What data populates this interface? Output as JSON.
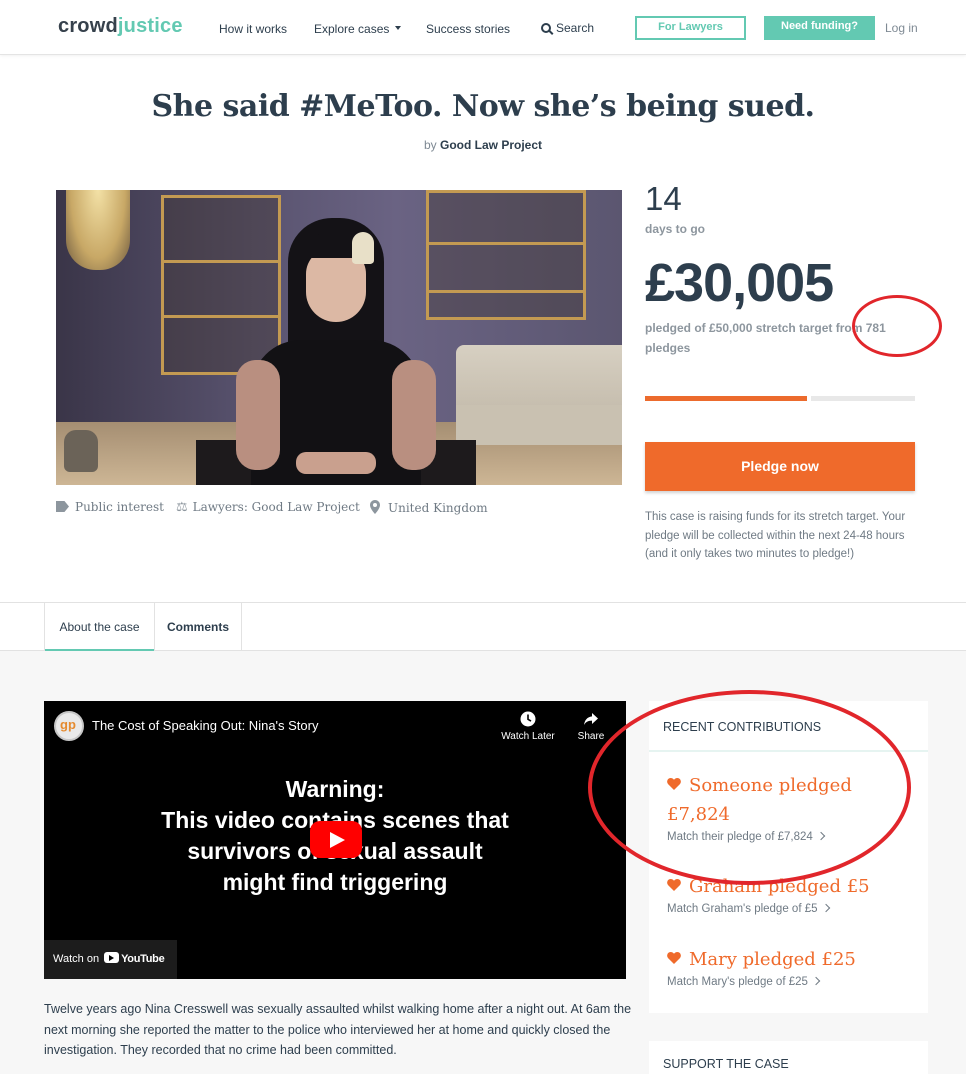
{
  "header": {
    "logo_part1": "crowd",
    "logo_part2": "justice",
    "nav": {
      "how_it_works": "How it works",
      "explore_cases": "Explore cases",
      "success_stories": "Success stories",
      "search": "Search"
    },
    "for_lawyers": "For Lawyers",
    "need_funding": "Need funding?",
    "login": "Log in"
  },
  "case": {
    "title": "She said #MeToo. Now she’s being sued.",
    "by_prefix": "by",
    "organiser": "Good Law Project",
    "meta": {
      "category": "Public interest",
      "lawyers": "Lawyers: Good Law Project",
      "location": "United Kingdom"
    }
  },
  "stats": {
    "days_number": "14",
    "days_label": "days to go",
    "amount": "£30,005",
    "pledged_text": "pledged of £50,000 stretch target from 781 pledges",
    "progress_fraction": 0.6,
    "pledge_button": "Pledge now",
    "stretch_note": "This case is raising funds for its stretch target. Your pledge will be collected within the next 24-48 hours (and it only takes two minutes to pledge!)"
  },
  "tabs": [
    {
      "label": "About the case",
      "active": true
    },
    {
      "label": "Comments",
      "active": false
    }
  ],
  "video": {
    "title": "The Cost of Speaking Out: Nina's Story",
    "watch_later": "Watch Later",
    "share": "Share",
    "warning_line1": "Warning:",
    "warning_line2": "This video contains scenes that",
    "warning_line3": "survivors of sexual assault",
    "warning_line4": "might find triggering",
    "watch_on": "Watch on",
    "youtube": "YouTube"
  },
  "story": {
    "paragraph": "Twelve years ago Nina Cresswell was sexually assaulted whilst walking home after a night out. At 6am the next morning she reported the matter to the police who interviewed her at home and quickly closed the investigation. They recorded that no crime had been committed."
  },
  "recent": {
    "heading": "RECENT CONTRIBUTIONS",
    "items": [
      {
        "headline": "Someone pledged £7,824",
        "sub": "Match their pledge of £7,824"
      },
      {
        "headline": "Graham pledged £5",
        "sub": "Match Graham's pledge of £5"
      },
      {
        "headline": "Mary pledged £25",
        "sub": "Match Mary's pledge of £25"
      }
    ]
  },
  "support": {
    "heading": "SUPPORT THE CASE"
  },
  "colors": {
    "accent_teal": "#63c9b2",
    "accent_orange": "#ef6a2b",
    "annotation_red": "#e1262b",
    "text_dark": "#2d3e4d"
  }
}
